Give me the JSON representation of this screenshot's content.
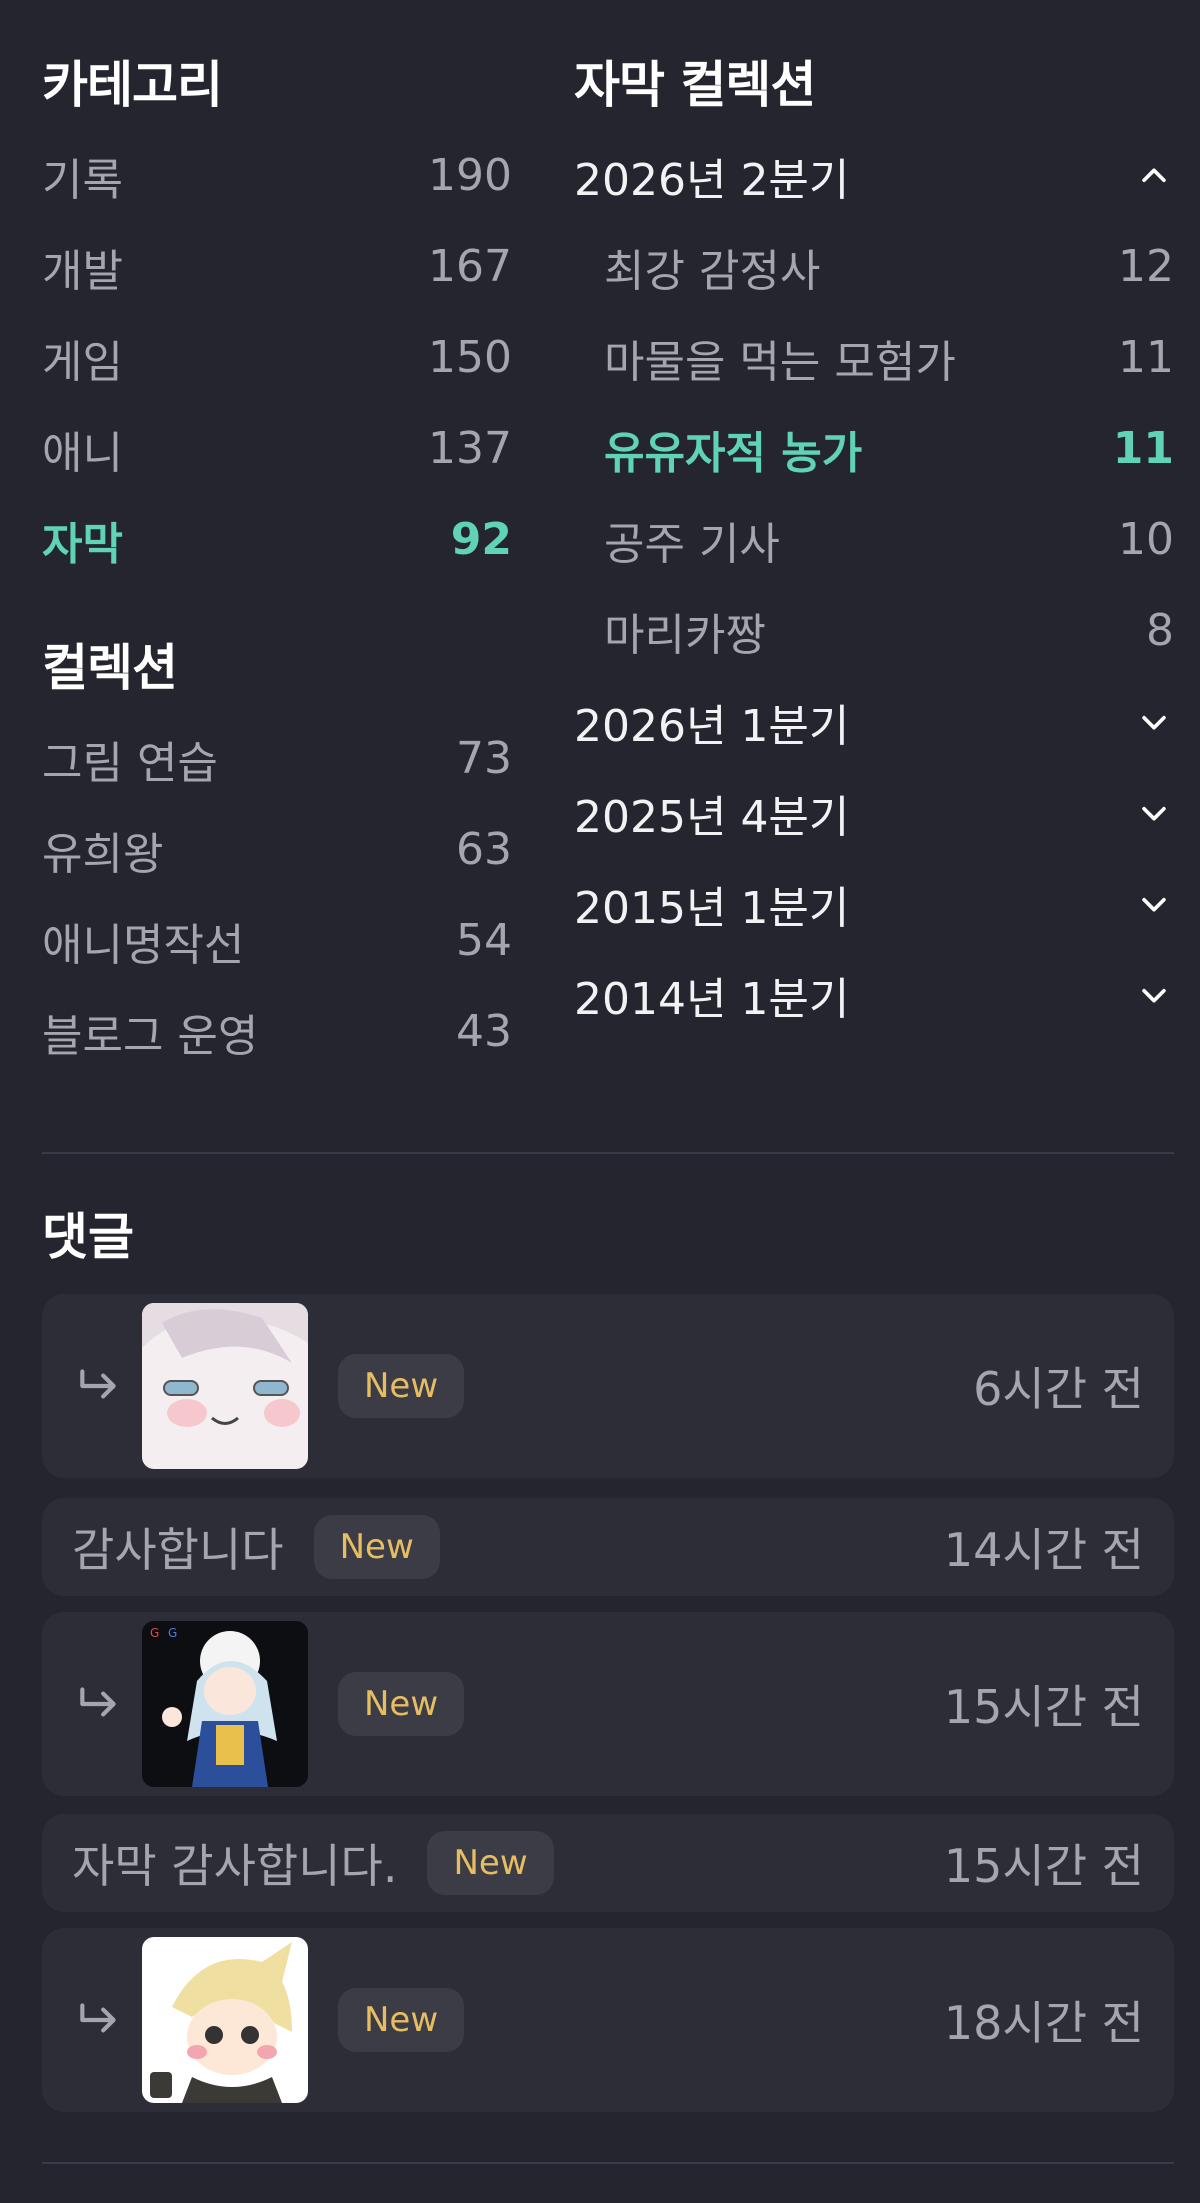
{
  "categories": {
    "title": "카테고리",
    "items": [
      {
        "label": "기록",
        "count": "190"
      },
      {
        "label": "개발",
        "count": "167"
      },
      {
        "label": "게임",
        "count": "150"
      },
      {
        "label": "애니",
        "count": "137"
      },
      {
        "label": "자막",
        "count": "92",
        "active": true
      }
    ]
  },
  "collections": {
    "title": "컬렉션",
    "items": [
      {
        "label": "그림 연습",
        "count": "73"
      },
      {
        "label": "유희왕",
        "count": "63"
      },
      {
        "label": "애니명작선",
        "count": "54"
      },
      {
        "label": "블로그 운영",
        "count": "43"
      }
    ]
  },
  "subtitle_collections": {
    "title": "자막 컬렉션",
    "quarters": [
      {
        "label": "2026년 2분기",
        "expanded": true,
        "icon": "chevron-up-icon",
        "items": [
          {
            "label": "최강 감정사",
            "count": "12"
          },
          {
            "label": "마물을 먹는 모험가",
            "count": "11"
          },
          {
            "label": "유유자적 농가",
            "count": "11",
            "active": true
          },
          {
            "label": "공주 기사",
            "count": "10"
          },
          {
            "label": "마리카짱",
            "count": "8"
          }
        ]
      },
      {
        "label": "2026년 1분기",
        "expanded": false,
        "icon": "chevron-down-icon"
      },
      {
        "label": "2025년 4분기",
        "expanded": false,
        "icon": "chevron-down-icon"
      },
      {
        "label": "2015년 1분기",
        "expanded": false,
        "icon": "chevron-down-icon"
      },
      {
        "label": "2014년 1분기",
        "expanded": false,
        "icon": "chevron-down-icon"
      }
    ]
  },
  "comments": {
    "title": "댓글",
    "items": [
      {
        "kind": "image",
        "badge": "New",
        "time": "6시간 전",
        "icon": "reply-arrow-icon"
      },
      {
        "kind": "text",
        "text": "감사합니다",
        "badge": "New",
        "time": "14시간 전"
      },
      {
        "kind": "image",
        "badge": "New",
        "time": "15시간 전",
        "icon": "reply-arrow-icon"
      },
      {
        "kind": "text",
        "text": "자막 감사합니다.",
        "badge": "New",
        "time": "15시간 전"
      },
      {
        "kind": "image",
        "badge": "New",
        "time": "18시간 전",
        "icon": "reply-arrow-icon"
      }
    ]
  },
  "colors": {
    "background": "#24252f",
    "card": "#2c2d37",
    "accent": "#5fd3b4",
    "badge_text": "#e7bd62"
  }
}
